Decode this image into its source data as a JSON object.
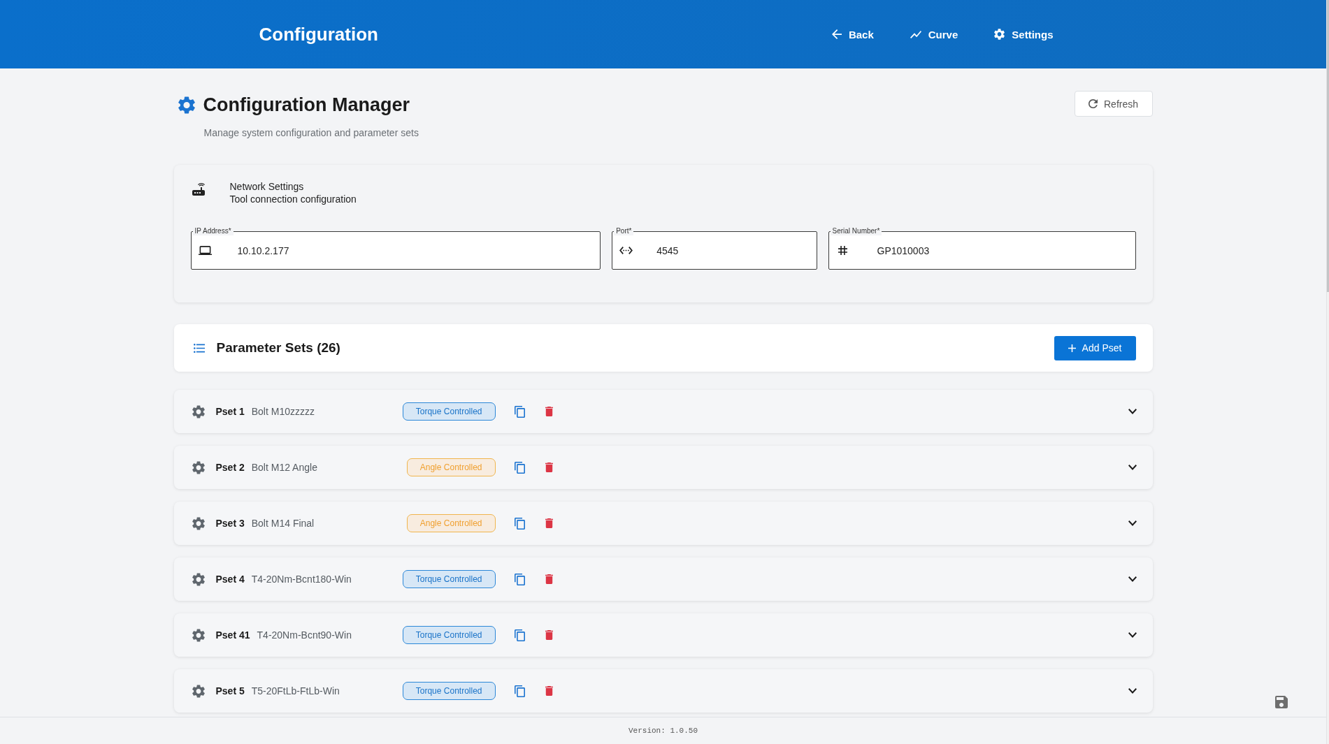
{
  "header": {
    "title": "Configuration",
    "nav": [
      {
        "kind": "back",
        "label": "Back"
      },
      {
        "kind": "curve",
        "label": "Curve"
      },
      {
        "kind": "settings",
        "label": "Settings"
      }
    ]
  },
  "page": {
    "title": "Configuration Manager",
    "subtitle": "Manage system configuration and parameter sets",
    "refresh_button": "Refresh"
  },
  "network_settings": {
    "title": "Network Settings",
    "subtitle": "Tool connection configuration",
    "fields": [
      {
        "kind": "ip",
        "label": "IP Address*",
        "value": "10.10.2.177"
      },
      {
        "kind": "port",
        "label": "Port*",
        "value": "4545"
      },
      {
        "kind": "serial",
        "label": "Serial Number*",
        "value": "GP1010003"
      }
    ]
  },
  "parameter_sets": {
    "title": "Parameter Sets (26)",
    "add_button": "Add Pset",
    "items": [
      {
        "label": "Pset 1",
        "name": "Bolt M10zzzzz",
        "mode": {
          "kind": "torque",
          "label": "Torque Controlled"
        },
        "expanded": false
      },
      {
        "label": "Pset 2",
        "name": "Bolt M12 Angle",
        "mode": {
          "kind": "angle",
          "label": "Angle Controlled"
        },
        "expanded": false
      },
      {
        "label": "Pset 3",
        "name": "Bolt M14 Final",
        "mode": {
          "kind": "angle",
          "label": "Angle Controlled"
        },
        "expanded": false
      },
      {
        "label": "Pset 4",
        "name": "T4-20Nm-Bcnt180-Win",
        "mode": {
          "kind": "torque",
          "label": "Torque Controlled"
        },
        "expanded": false
      },
      {
        "label": "Pset 41",
        "name": "T4-20Nm-Bcnt90-Win",
        "mode": {
          "kind": "torque",
          "label": "Torque Controlled"
        },
        "expanded": false
      },
      {
        "label": "Pset 5",
        "name": "T5-20FtLb-FtLb-Win",
        "mode": {
          "kind": "torque",
          "label": "Torque Controlled"
        },
        "expanded": false
      }
    ]
  },
  "footer": {
    "version": "Version: 1.0.50"
  }
}
